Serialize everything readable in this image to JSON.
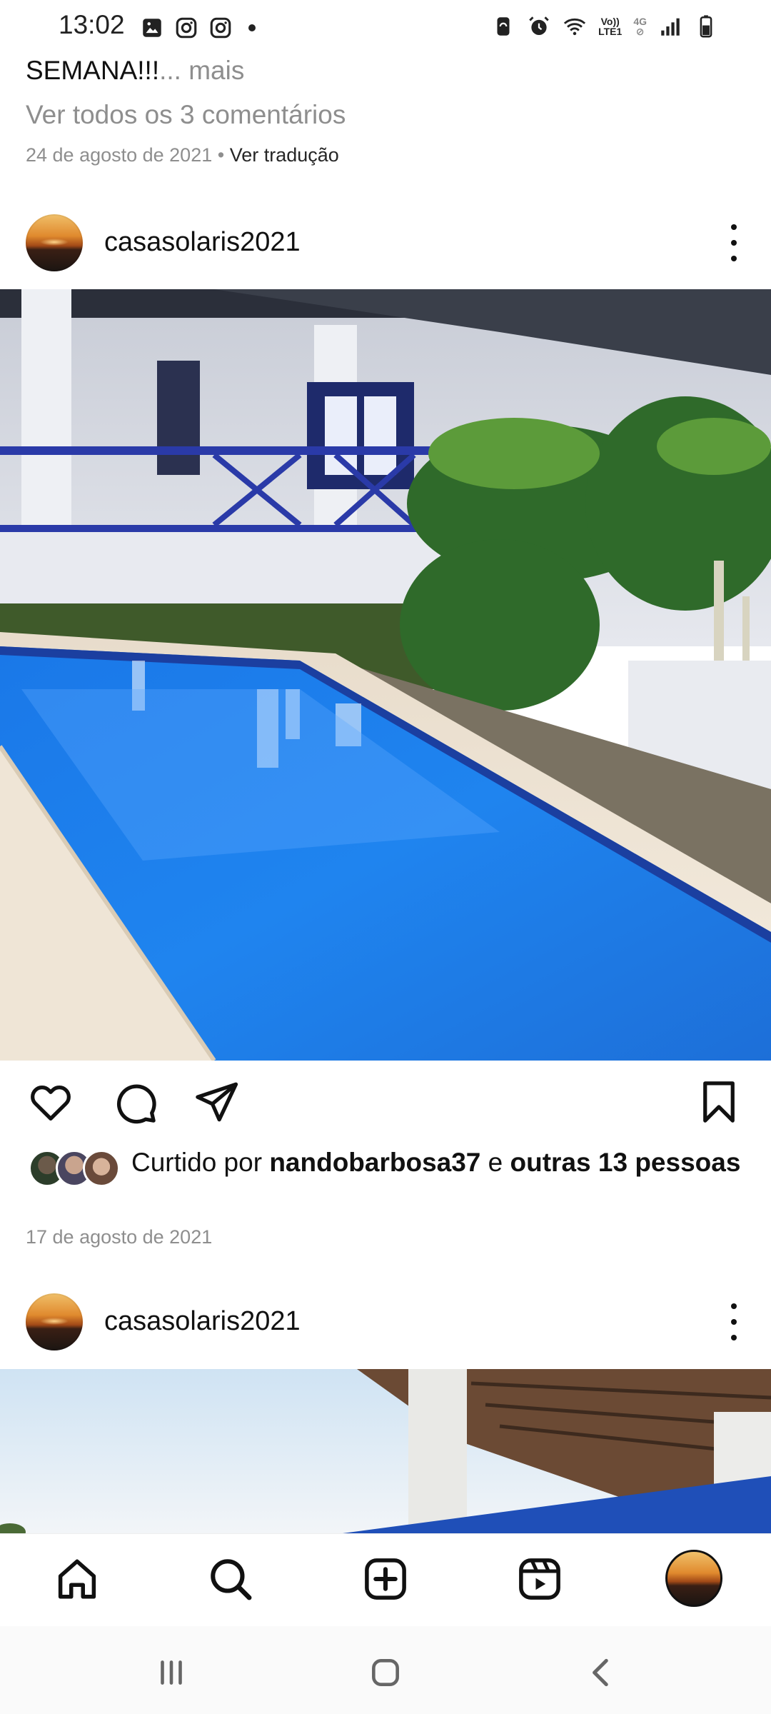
{
  "status_bar": {
    "time": "13:02",
    "left_icons": [
      "gallery-icon",
      "instagram-icon",
      "instagram-icon",
      "notification-dot"
    ],
    "right_icons": [
      "battery-saver-icon",
      "alarm-icon",
      "wifi-icon",
      "volte-icon",
      "4g-icon",
      "signal-icon",
      "battery-icon"
    ],
    "volte_label_top": "Vo))",
    "volte_label_bottom": "LTE1",
    "network_label": "4G"
  },
  "previous_post": {
    "caption_tail": "SEMANA!!!",
    "more_label": "... mais",
    "view_comments": "Ver todos os 3 comentários",
    "date": "24 de agosto de 2021",
    "separator": " • ",
    "translate_label": "Ver tradução"
  },
  "post": {
    "username": "casasolaris2021",
    "liked_by_prefix": "Curtido por ",
    "liked_by_user": "nandobarbosa37",
    "liked_by_join": " e ",
    "liked_by_others": "outras 13 pessoas",
    "date": "17 de agosto de 2021",
    "actions": [
      "heart-icon",
      "comment-icon",
      "share-icon",
      "bookmark-icon"
    ]
  },
  "next_post": {
    "username": "casasolaris2021"
  },
  "bottom_nav": {
    "items": [
      "home-icon",
      "search-icon",
      "new-post-icon",
      "reels-icon",
      "profile-avatar"
    ]
  },
  "system_nav": {
    "items": [
      "recent-apps-button",
      "home-button",
      "back-button"
    ]
  },
  "colors": {
    "muted_text": "#8e8e8e",
    "text": "#111111",
    "pool_blue": "#1f7fe0"
  }
}
